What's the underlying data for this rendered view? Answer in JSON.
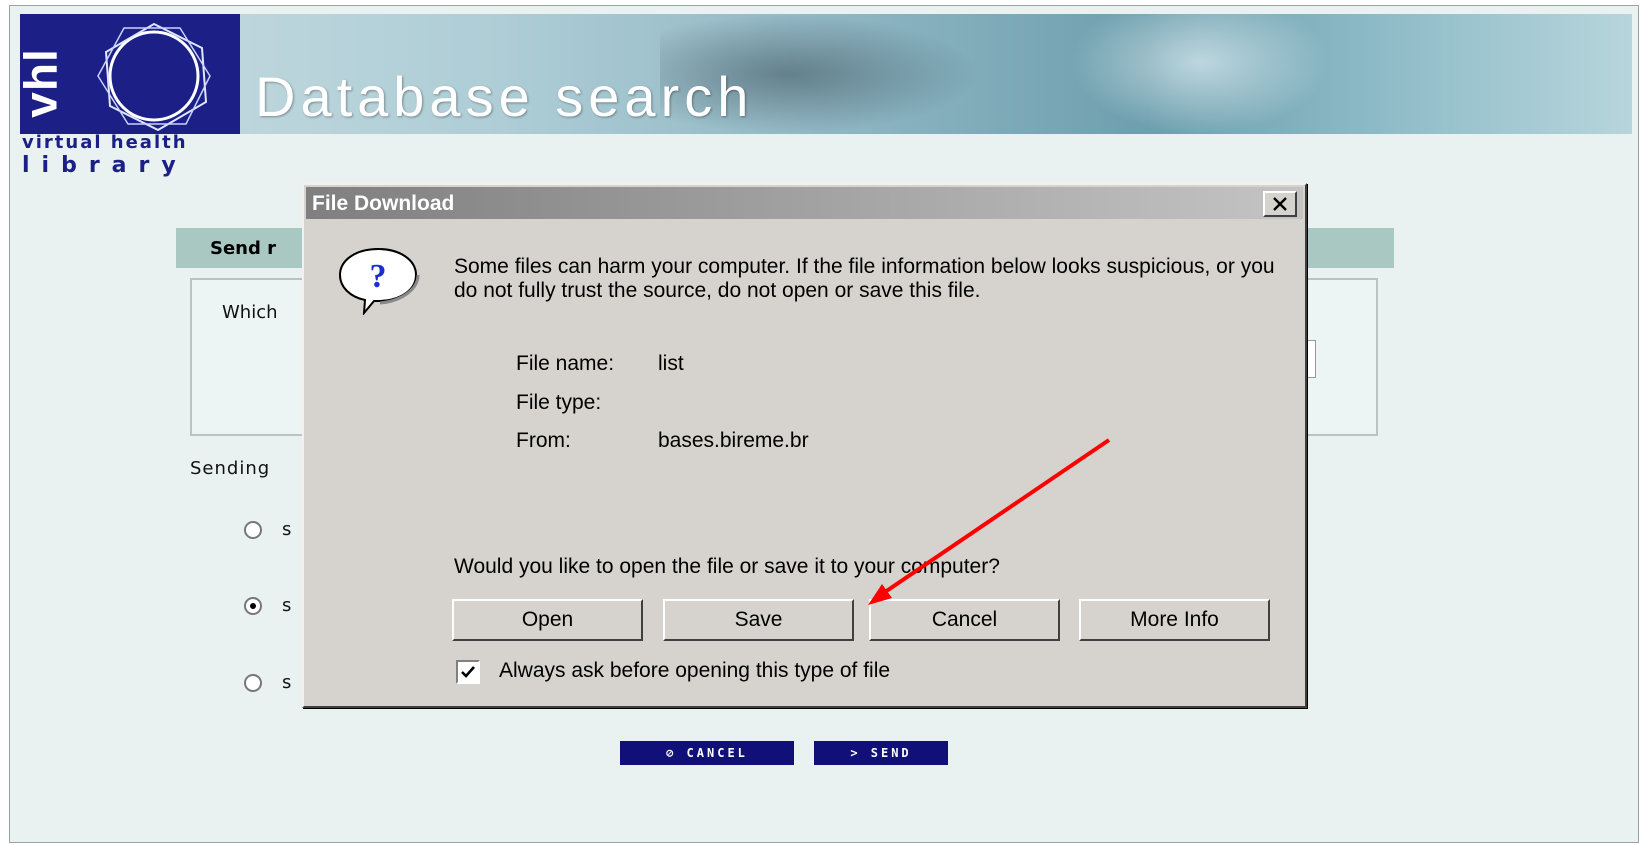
{
  "banner": {
    "logo_text": "vhl",
    "title": "Database search",
    "subtitle_line1": "virtual health",
    "subtitle_line2": "library"
  },
  "form": {
    "section_title": "Send r",
    "which_label": "Which",
    "sending_label": "Sending",
    "radio_options": [
      {
        "label": "s",
        "checked": false
      },
      {
        "label": "s",
        "checked": true
      },
      {
        "label": "s",
        "checked": false
      }
    ],
    "cancel_button": "⊘ CANCEL",
    "send_button": "> SEND"
  },
  "dialog": {
    "title": "File Download",
    "close_label": "✕",
    "warning": "Some files can harm your computer. If the file information below looks suspicious, or you do not fully trust the source, do not open or save this file.",
    "file_name_label": "File name:",
    "file_name": "list",
    "file_type_label": "File type:",
    "file_type": "",
    "from_label": "From:",
    "from": "bases.bireme.br",
    "question": "Would you like to open the file or save it to your computer?",
    "buttons": {
      "open": "Open",
      "save": "Save",
      "cancel": "Cancel",
      "more_info": "More Info"
    },
    "always_ask_checked": true,
    "always_ask_label": "Always ask before opening this type of file"
  },
  "colors": {
    "annotation_arrow": "#ff0000",
    "vhl_blue": "#1b1f86",
    "button_navy": "#101078"
  }
}
